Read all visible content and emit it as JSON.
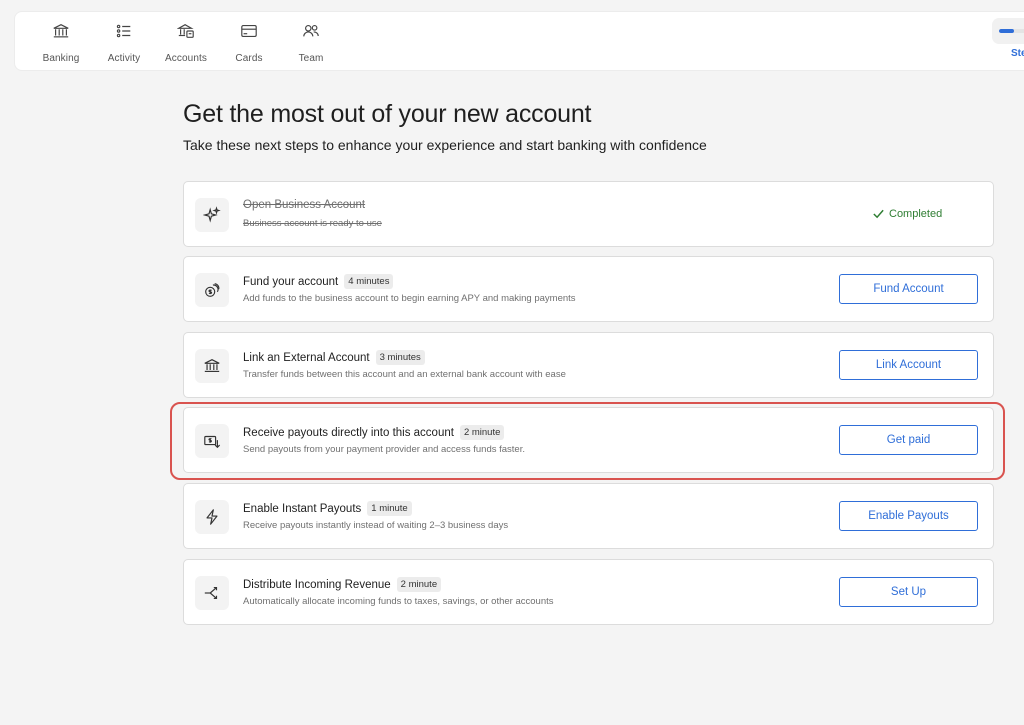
{
  "nav": {
    "items": [
      {
        "label": "Banking",
        "icon": "bank-icon"
      },
      {
        "label": "Activity",
        "icon": "list-icon"
      },
      {
        "label": "Accounts",
        "icon": "accounts-icon"
      },
      {
        "label": "Cards",
        "icon": "card-icon"
      },
      {
        "label": "Team",
        "icon": "team-icon"
      }
    ],
    "right_label": "Ste",
    "progress": 0.5,
    "accent": "#2f6ed8"
  },
  "page": {
    "title": "Get the most out of your new account",
    "subtitle": "Take these next steps to enhance your experience and start banking with confidence"
  },
  "steps": [
    {
      "title": "Open Business Account",
      "badge": "",
      "desc": "Business account is ready to use",
      "status": "Completed",
      "icon": "sparkle-icon",
      "done": true
    },
    {
      "title": "Fund your account",
      "badge": "4 minutes",
      "desc": "Add funds to the business account to begin earning APY and making payments",
      "button": "Fund Account",
      "icon": "coins-icon"
    },
    {
      "title": "Link an External Account",
      "badge": "3 minutes",
      "desc": "Transfer funds between this account and an external bank account with ease",
      "button": "Link Account",
      "icon": "bank-icon"
    },
    {
      "title": "Receive payouts directly into this account",
      "badge": "2 minute",
      "desc": "Send payouts from your payment provider and access funds faster.",
      "button": "Get paid",
      "icon": "money-in-icon"
    },
    {
      "title": "Enable Instant Payouts",
      "badge": "1 minute",
      "desc": "Receive payouts instantly instead of waiting 2–3 business days",
      "button": "Enable Payouts",
      "icon": "lightning-icon"
    },
    {
      "title": "Distribute Incoming Revenue",
      "badge": "2 minute",
      "desc": "Automatically allocate incoming funds to taxes, savings, or other accounts",
      "button": "Set Up",
      "icon": "split-icon"
    }
  ],
  "colors": {
    "highlight": "#d9534f",
    "completed": "#2e7d32",
    "button": "#2f6ed8"
  }
}
